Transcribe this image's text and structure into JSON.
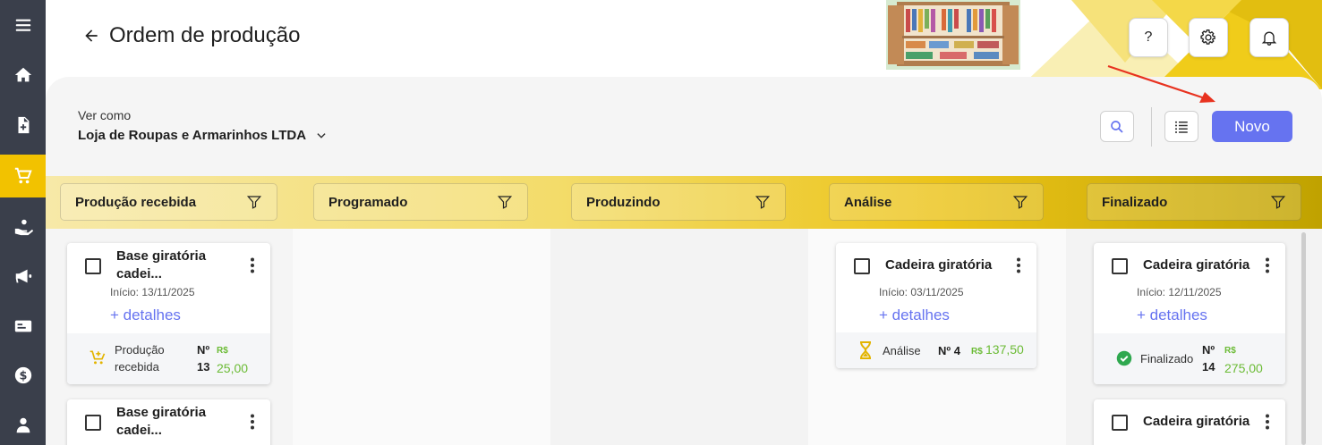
{
  "header": {
    "title": "Ordem de produção",
    "help_label": "?"
  },
  "view_as": {
    "label": "Ver como",
    "value": "Loja de Roupas e Armarinhos LTDA"
  },
  "toolbar": {
    "new_label": "Novo"
  },
  "columns": [
    {
      "label": "Produção recebida"
    },
    {
      "label": "Programado"
    },
    {
      "label": "Produzindo"
    },
    {
      "label": "Análise"
    },
    {
      "label": "Finalizado"
    }
  ],
  "cards": {
    "c1": {
      "title_line1": "Base giratória",
      "title_line2": "cadei...",
      "date": "Início: 13/11/2025",
      "link": "+ detalhes",
      "status_line1": "Produção",
      "status_line2": "recebida",
      "num_line1": "Nº",
      "num_line2": "13",
      "currency": "R$",
      "value": "25,00"
    },
    "c2": {
      "title_line1": "Base giratória",
      "title_line2": "cadei..."
    },
    "c3": {
      "title": "Cadeira giratória",
      "date": "Início: 03/11/2025",
      "link": "+ detalhes",
      "status": "Análise",
      "num": "Nº 4",
      "currency": "R$",
      "value": "137,50"
    },
    "c4": {
      "title": "Cadeira giratória",
      "date": "Início: 12/11/2025",
      "link": "+ detalhes",
      "status": "Finalizado",
      "num_line1": "Nº",
      "num_line2": "14",
      "currency": "R$",
      "value": "275,00"
    },
    "c5": {
      "title": "Cadeira giratória"
    }
  },
  "colors": {
    "accent": "#6673f0",
    "rail": "#3a3f4b",
    "rail_active": "#f2c200",
    "money": "#6bbb35"
  },
  "icons": [
    "menu-icon",
    "home-icon",
    "document-add-icon",
    "cart-icon",
    "hand-coin-icon",
    "megaphone-icon",
    "card-icon",
    "dollar-icon",
    "user-icon",
    "back-arrow-icon",
    "gear-icon",
    "bell-icon",
    "search-icon",
    "list-icon",
    "filter-icon",
    "kebab-icon",
    "cart-add-icon",
    "hourglass-icon",
    "check-circle-icon"
  ]
}
